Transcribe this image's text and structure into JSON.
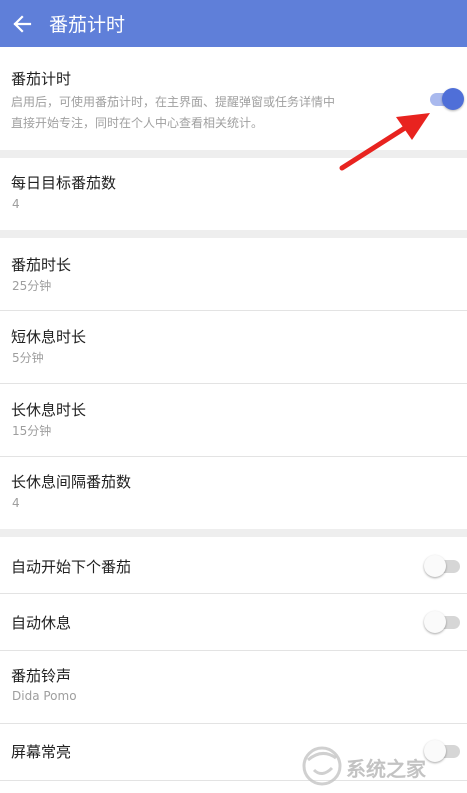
{
  "appbar": {
    "title": "番茄计时",
    "background": "#5f7fd9",
    "back_icon": "arrow-left-icon"
  },
  "pomodoro_toggle": {
    "title": "番茄计时",
    "description_line1": "启用后，可使用番茄计时，在主界面、提醒弹窗或任务详情中",
    "description_line2": "直接开始专注，同时在个人中心查看相关统计。",
    "enabled": true
  },
  "daily_goal": {
    "title": "每日目标番茄数",
    "value": "4"
  },
  "durations": [
    {
      "title": "番茄时长",
      "value": "25分钟"
    },
    {
      "title": "短休息时长",
      "value": "5分钟"
    },
    {
      "title": "长休息时长",
      "value": "15分钟"
    },
    {
      "title": "长休息间隔番茄数",
      "value": "4"
    }
  ],
  "auto_start_next": {
    "title": "自动开始下个番茄",
    "enabled": false
  },
  "auto_rest": {
    "title": "自动休息",
    "enabled": false
  },
  "ringtone": {
    "title": "番茄铃声",
    "value": "Dida Pomo"
  },
  "screen_on": {
    "title": "屏幕常亮",
    "enabled": false
  },
  "annotation": {
    "color": "#e8231f"
  },
  "watermark": {
    "text": "系统之家"
  },
  "colors": {
    "accent": "#4f6fd8",
    "divider": "#eeeeee"
  }
}
